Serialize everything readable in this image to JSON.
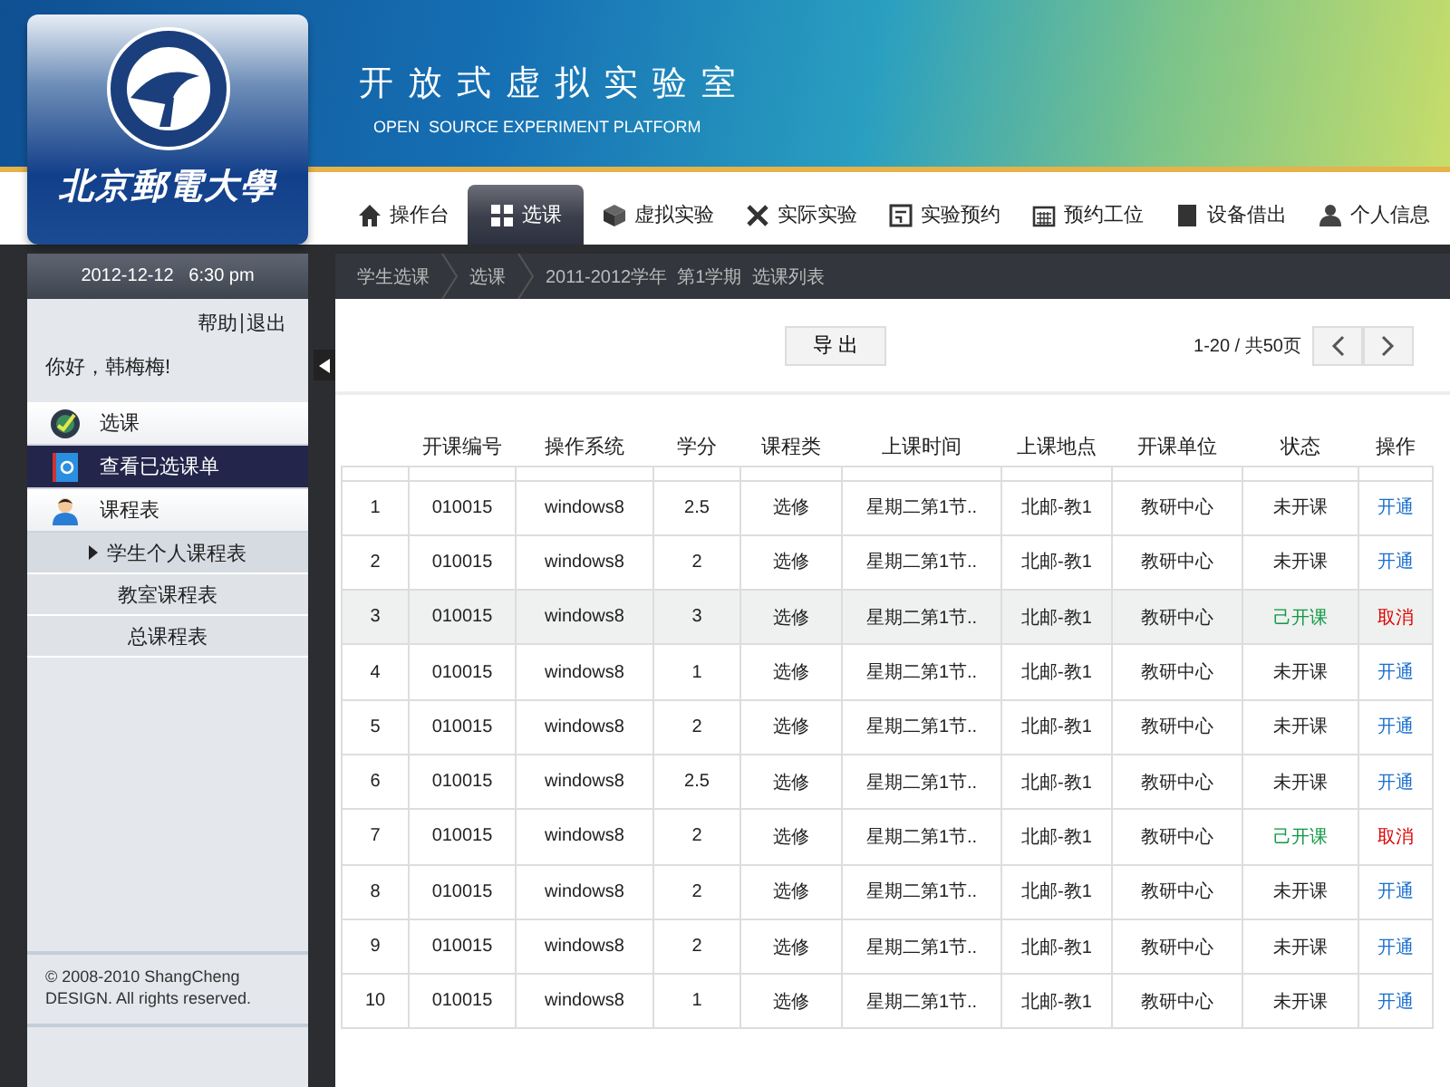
{
  "header": {
    "logo_text": "北京郵電大學",
    "title": "开放式虚拟实验室",
    "subtitle": "OPEN  SOURCE EXPERIMENT PLATFORM"
  },
  "nav": [
    {
      "label": "操作台",
      "selected": false
    },
    {
      "label": "选课",
      "selected": true
    },
    {
      "label": "虚拟实验",
      "selected": false
    },
    {
      "label": "实际实验",
      "selected": false
    },
    {
      "label": "实验预约",
      "selected": false
    },
    {
      "label": "预约工位",
      "selected": false
    },
    {
      "label": "设备借出",
      "selected": false
    },
    {
      "label": "个人信息",
      "selected": false
    }
  ],
  "sidebar": {
    "datetime": "2012-12-12   6:30 pm",
    "links": [
      "帮助",
      "退出"
    ],
    "greeting": "你好，韩梅梅!",
    "menu": [
      {
        "label": "选课",
        "selected": false
      },
      {
        "label": "查看已选课单",
        "selected": true
      },
      {
        "label": "课程表",
        "selected": false,
        "children": [
          {
            "label": "学生个人课程表",
            "selected": true
          },
          {
            "label": "教室课程表",
            "selected": false
          },
          {
            "label": "总课程表",
            "selected": false
          }
        ]
      }
    ],
    "footer": "© 2008-2010 ShangCheng DESIGN. All rights reserved."
  },
  "breadcrumb": [
    "学生选课",
    "选课",
    "2011-2012学年  第1学期  选课列表"
  ],
  "toolbar": {
    "export_button": "导 出",
    "page_info": "1-20 / 共50页"
  },
  "table": {
    "columns": [
      "",
      "开课编号",
      "操作系统",
      "学分",
      "课程类",
      "上课时间",
      "上课地点",
      "开课单位",
      "状态",
      "操作"
    ],
    "rows": [
      {
        "cells": [
          "1",
          "010015",
          "windows8",
          "2.5",
          "选修",
          "星期二第1节..",
          "北邮-教1",
          "教研中心"
        ],
        "status": "未开课",
        "action": "开通",
        "kind": "closed",
        "highlighted": false
      },
      {
        "cells": [
          "2",
          "010015",
          "windows8",
          "2",
          "选修",
          "星期二第1节..",
          "北邮-教1",
          "教研中心"
        ],
        "status": "未开课",
        "action": "开通",
        "kind": "closed",
        "highlighted": false
      },
      {
        "cells": [
          "3",
          "010015",
          "windows8",
          "3",
          "选修",
          "星期二第1节..",
          "北邮-教1",
          "教研中心"
        ],
        "status": "己开课",
        "action": "取消",
        "kind": "open",
        "highlighted": true
      },
      {
        "cells": [
          "4",
          "010015",
          "windows8",
          "1",
          "选修",
          "星期二第1节..",
          "北邮-教1",
          "教研中心"
        ],
        "status": "未开课",
        "action": "开通",
        "kind": "closed",
        "highlighted": false
      },
      {
        "cells": [
          "5",
          "010015",
          "windows8",
          "2",
          "选修",
          "星期二第1节..",
          "北邮-教1",
          "教研中心"
        ],
        "status": "未开课",
        "action": "开通",
        "kind": "closed",
        "highlighted": false
      },
      {
        "cells": [
          "6",
          "010015",
          "windows8",
          "2.5",
          "选修",
          "星期二第1节..",
          "北邮-教1",
          "教研中心"
        ],
        "status": "未开课",
        "action": "开通",
        "kind": "closed",
        "highlighted": false
      },
      {
        "cells": [
          "7",
          "010015",
          "windows8",
          "2",
          "选修",
          "星期二第1节..",
          "北邮-教1",
          "教研中心"
        ],
        "status": "己开课",
        "action": "取消",
        "kind": "open",
        "highlighted": false
      },
      {
        "cells": [
          "8",
          "010015",
          "windows8",
          "2",
          "选修",
          "星期二第1节..",
          "北邮-教1",
          "教研中心"
        ],
        "status": "未开课",
        "action": "开通",
        "kind": "closed",
        "highlighted": false
      },
      {
        "cells": [
          "9",
          "010015",
          "windows8",
          "2",
          "选修",
          "星期二第1节..",
          "北邮-教1",
          "教研中心"
        ],
        "status": "未开课",
        "action": "开通",
        "kind": "closed",
        "highlighted": false
      },
      {
        "cells": [
          "10",
          "010015",
          "windows8",
          "1",
          "选修",
          "星期二第1节..",
          "北邮-教1",
          "教研中心"
        ],
        "status": "未开课",
        "action": "开通",
        "kind": "closed",
        "highlighted": false
      }
    ]
  }
}
